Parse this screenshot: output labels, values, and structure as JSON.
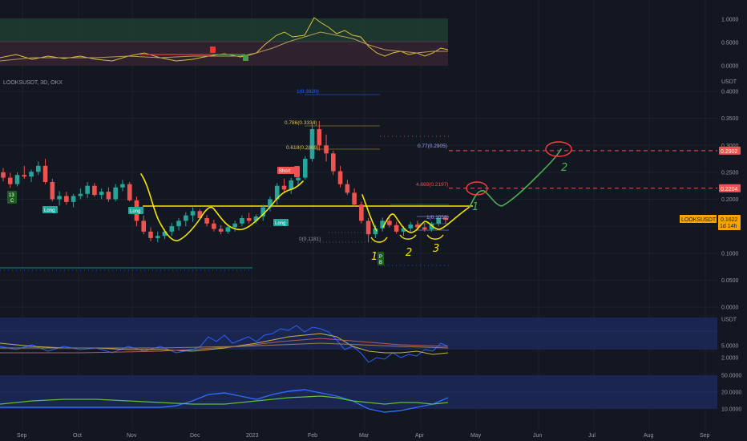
{
  "symbol_label": "LOOKSUSDT, 3D, OKX",
  "currency_label": "USDT",
  "price_tag": {
    "symbol": "LOOKSUSDT",
    "price": "0.1622",
    "countdown": "1d 14h"
  },
  "level_tags": [
    "0.2902",
    "0.2204"
  ],
  "colors": {
    "up": "#26a69a",
    "down": "#ef5350",
    "annotation_yellow": "#f5e600",
    "projection_green": "#4caf50",
    "circle_red": "#ff3b3b",
    "fib_blue": "#2962ff",
    "fib_gold": "#c9a227"
  },
  "fib_labels": [
    {
      "text": "1(0.3920)",
      "color": "#2962ff"
    },
    {
      "text": "0.786(0.3334)",
      "color": "#e0c35a"
    },
    {
      "text": "0.618(0.2869)",
      "color": "#e0c35a"
    },
    {
      "text": "0(0.1181)",
      "color": "#9598a1"
    },
    {
      "text": "0.77(0.2905)",
      "color": "#9fa8ff"
    },
    {
      "text": "4.669(0.2197)",
      "color": "#ef5350"
    },
    {
      "text": "1(0.1550)",
      "color": "#9fa8ff"
    }
  ],
  "signals": [
    {
      "text": "Long",
      "kind": "long"
    },
    {
      "text": "Long",
      "kind": "long"
    },
    {
      "text": "Long",
      "kind": "long"
    },
    {
      "text": "Short",
      "kind": "short"
    },
    {
      "text": "13\nC",
      "kind": "count"
    },
    {
      "text": "P\nB",
      "kind": "pb"
    }
  ],
  "hand_labels": [
    "1",
    "2",
    "3",
    "1",
    "2"
  ],
  "chart_data": [
    {
      "type": "candlestick",
      "title": "LOOKSUSDT, 3D, OKX",
      "ylabel": "USDT",
      "ylim": [
        0,
        0.4
      ],
      "y_ticks": [
        "0.4000",
        "0.3500",
        "0.3000",
        "0.2500",
        "0.2000",
        "0.1500",
        "0.1000",
        "0.0500",
        "0.0000"
      ],
      "x_ticks": [
        "Sep",
        "Oct",
        "Nov",
        "Dec",
        "2023",
        "Feb",
        "Mar",
        "Apr",
        "May",
        "Jun",
        "Jul",
        "Aug",
        "Sep"
      ],
      "candles": [
        [
          0.25,
          0.258,
          0.233,
          0.24
        ],
        [
          0.24,
          0.249,
          0.221,
          0.228
        ],
        [
          0.228,
          0.25,
          0.224,
          0.245
        ],
        [
          0.245,
          0.262,
          0.238,
          0.242
        ],
        [
          0.242,
          0.255,
          0.232,
          0.251
        ],
        [
          0.251,
          0.27,
          0.245,
          0.262
        ],
        [
          0.262,
          0.275,
          0.228,
          0.232
        ],
        [
          0.232,
          0.238,
          0.196,
          0.2
        ],
        [
          0.2,
          0.215,
          0.188,
          0.206
        ],
        [
          0.206,
          0.214,
          0.19,
          0.195
        ],
        [
          0.195,
          0.21,
          0.185,
          0.206
        ],
        [
          0.206,
          0.22,
          0.2,
          0.21
        ],
        [
          0.21,
          0.232,
          0.202,
          0.225
        ],
        [
          0.225,
          0.23,
          0.205,
          0.208
        ],
        [
          0.208,
          0.22,
          0.2,
          0.214
        ],
        [
          0.214,
          0.222,
          0.195,
          0.2
        ],
        [
          0.2,
          0.228,
          0.196,
          0.222
        ],
        [
          0.222,
          0.236,
          0.215,
          0.228
        ],
        [
          0.228,
          0.232,
          0.196,
          0.198
        ],
        [
          0.198,
          0.205,
          0.15,
          0.16
        ],
        [
          0.16,
          0.17,
          0.135,
          0.14
        ],
        [
          0.14,
          0.148,
          0.122,
          0.128
        ],
        [
          0.128,
          0.14,
          0.12,
          0.132
        ],
        [
          0.132,
          0.145,
          0.126,
          0.14
        ],
        [
          0.14,
          0.156,
          0.132,
          0.15
        ],
        [
          0.15,
          0.165,
          0.142,
          0.16
        ],
        [
          0.16,
          0.176,
          0.15,
          0.17
        ],
        [
          0.17,
          0.185,
          0.158,
          0.178
        ],
        [
          0.178,
          0.182,
          0.162,
          0.165
        ],
        [
          0.165,
          0.17,
          0.15,
          0.155
        ],
        [
          0.155,
          0.162,
          0.14,
          0.145
        ],
        [
          0.145,
          0.152,
          0.135,
          0.14
        ],
        [
          0.14,
          0.152,
          0.136,
          0.148
        ],
        [
          0.148,
          0.16,
          0.14,
          0.155
        ],
        [
          0.155,
          0.17,
          0.15,
          0.165
        ],
        [
          0.165,
          0.175,
          0.155,
          0.16
        ],
        [
          0.16,
          0.172,
          0.155,
          0.168
        ],
        [
          0.168,
          0.19,
          0.16,
          0.185
        ],
        [
          0.185,
          0.205,
          0.178,
          0.2
        ],
        [
          0.2,
          0.23,
          0.19,
          0.225
        ],
        [
          0.225,
          0.238,
          0.212,
          0.218
        ],
        [
          0.218,
          0.24,
          0.21,
          0.235
        ],
        [
          0.235,
          0.245,
          0.225,
          0.24
        ],
        [
          0.24,
          0.28,
          0.236,
          0.275
        ],
        [
          0.275,
          0.34,
          0.27,
          0.33
        ],
        [
          0.33,
          0.345,
          0.29,
          0.3
        ],
        [
          0.3,
          0.32,
          0.27,
          0.285
        ],
        [
          0.285,
          0.29,
          0.245,
          0.252
        ],
        [
          0.252,
          0.262,
          0.222,
          0.228
        ],
        [
          0.228,
          0.236,
          0.208,
          0.212
        ],
        [
          0.212,
          0.22,
          0.186,
          0.19
        ],
        [
          0.19,
          0.196,
          0.155,
          0.16
        ],
        [
          0.16,
          0.165,
          0.12,
          0.135
        ],
        [
          0.135,
          0.152,
          0.128,
          0.146
        ],
        [
          0.146,
          0.166,
          0.14,
          0.16
        ],
        [
          0.16,
          0.17,
          0.148,
          0.152
        ],
        [
          0.152,
          0.158,
          0.136,
          0.14
        ],
        [
          0.14,
          0.15,
          0.132,
          0.146
        ],
        [
          0.146,
          0.158,
          0.14,
          0.153
        ],
        [
          0.153,
          0.16,
          0.142,
          0.148
        ],
        [
          0.148,
          0.156,
          0.14,
          0.144
        ],
        [
          0.144,
          0.158,
          0.14,
          0.155
        ],
        [
          0.155,
          0.168,
          0.15,
          0.165
        ],
        [
          0.165,
          0.17,
          0.155,
          0.162
        ]
      ],
      "horizontal_levels": [
        {
          "label": "0.2902",
          "value": 0.2902,
          "style": "dashed",
          "color": "#ef5350"
        },
        {
          "label": "0.2204",
          "value": 0.2204,
          "style": "dashed",
          "color": "#ef5350"
        }
      ],
      "neckline": 0.18
    },
    {
      "type": "line",
      "title": "",
      "y_ticks": [
        "1.0000",
        "0.5000",
        "0.0000"
      ],
      "ylim": [
        0,
        1
      ],
      "series": []
    },
    {
      "type": "line",
      "title": "",
      "y_ticks": [
        "USDT",
        "5.0000",
        "2.0000",
        "50.0000"
      ],
      "series": []
    },
    {
      "type": "line",
      "title": "",
      "y_ticks": [
        "20.0000",
        "10.0000"
      ],
      "series": []
    }
  ]
}
